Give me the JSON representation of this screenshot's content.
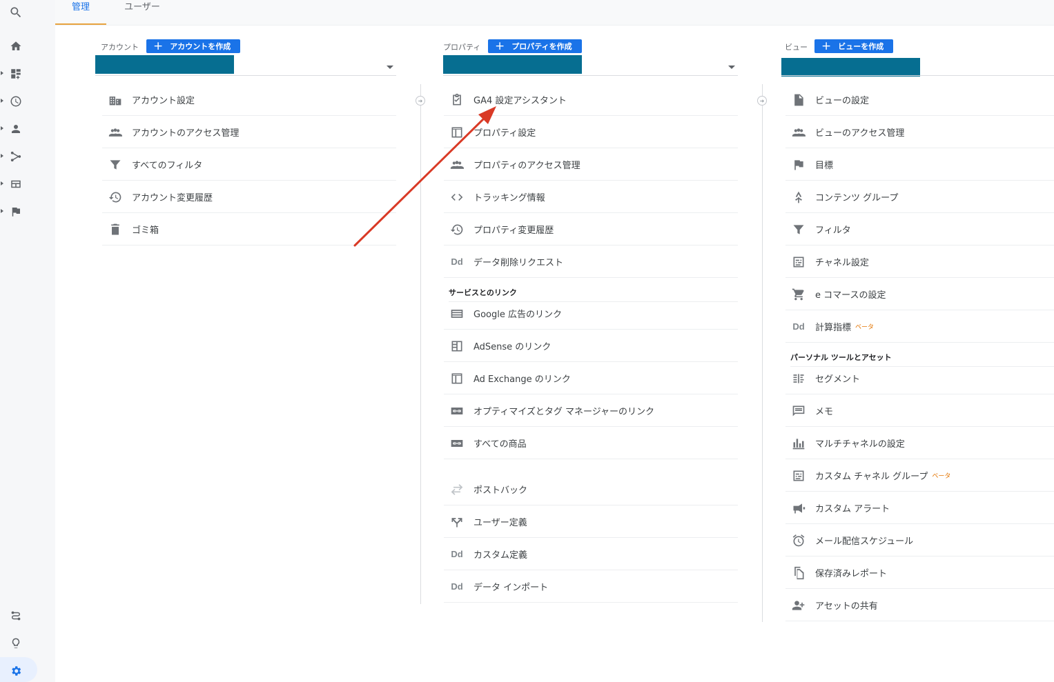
{
  "tabs": [
    {
      "label": "管理",
      "active": true
    },
    {
      "label": "ユーザー",
      "active": false
    }
  ],
  "account": {
    "label": "アカウント",
    "create_label": "アカウントを作成",
    "items": [
      {
        "label": "アカウント設定",
        "icon": "building-icon"
      },
      {
        "label": "アカウントのアクセス管理",
        "icon": "people-icon"
      },
      {
        "label": "すべてのフィルタ",
        "icon": "filter-icon"
      },
      {
        "label": "アカウント変更履歴",
        "icon": "history-icon"
      },
      {
        "label": "ゴミ箱",
        "icon": "trash-icon"
      }
    ]
  },
  "property": {
    "label": "プロパティ",
    "create_label": "プロパティを作成",
    "items": [
      {
        "label": "GA4 設定アシスタント",
        "icon": "clipboard-check-icon"
      },
      {
        "label": "プロパティ設定",
        "icon": "window-icon"
      },
      {
        "label": "プロパティのアクセス管理",
        "icon": "people-icon"
      },
      {
        "label": "トラッキング情報",
        "icon": "code-icon"
      },
      {
        "label": "プロパティ変更履歴",
        "icon": "history-icon"
      },
      {
        "label": "データ削除リクエスト",
        "icon": "dd-icon",
        "glyph": "Dd"
      }
    ],
    "section_links": "サービスとのリンク",
    "link_items": [
      {
        "label": "Google 広告のリンク",
        "icon": "ads-icon"
      },
      {
        "label": "AdSense のリンク",
        "icon": "adsense-icon"
      },
      {
        "label": "Ad Exchange のリンク",
        "icon": "window-icon"
      },
      {
        "label": "オプティマイズとタグ マネージャーのリンク",
        "icon": "link-icon"
      },
      {
        "label": "すべての商品",
        "icon": "link-icon"
      }
    ],
    "extra_items": [
      {
        "label": "ポストバック",
        "icon": "swap-icon"
      },
      {
        "label": "ユーザー定義",
        "icon": "fork-icon"
      },
      {
        "label": "カスタム定義",
        "icon": "dd-icon",
        "glyph": "Dd"
      },
      {
        "label": "データ インポート",
        "icon": "dd-icon",
        "glyph": "Dd"
      }
    ]
  },
  "view": {
    "label": "ビュー",
    "create_label": "ビューを作成",
    "items": [
      {
        "label": "ビューの設定",
        "icon": "document-icon"
      },
      {
        "label": "ビューのアクセス管理",
        "icon": "people-icon"
      },
      {
        "label": "目標",
        "icon": "flag-icon"
      },
      {
        "label": "コンテンツ グループ",
        "icon": "person-walk-icon"
      },
      {
        "label": "フィルタ",
        "icon": "filter-icon"
      },
      {
        "label": "チャネル設定",
        "icon": "channel-icon"
      },
      {
        "label": "e コマースの設定",
        "icon": "cart-icon"
      },
      {
        "label": "計算指標",
        "icon": "dd-icon",
        "glyph": "Dd",
        "beta": "ベータ"
      }
    ],
    "section_personal": "パーソナル ツールとアセット",
    "personal_items": [
      {
        "label": "セグメント",
        "icon": "segment-icon"
      },
      {
        "label": "メモ",
        "icon": "note-icon"
      },
      {
        "label": "マルチチャネルの設定",
        "icon": "bars-icon"
      },
      {
        "label": "カスタム チャネル グループ",
        "icon": "channel-icon",
        "beta": "ベータ"
      },
      {
        "label": "カスタム アラート",
        "icon": "megaphone-icon"
      },
      {
        "label": "メール配信スケジュール",
        "icon": "alarm-icon"
      },
      {
        "label": "保存済みレポート",
        "icon": "copy-icon"
      },
      {
        "label": "アセットの共有",
        "icon": "person-add-icon"
      }
    ]
  },
  "colors": {
    "accent": "#1a73e8",
    "selector": "#066e91",
    "arrow": "#d93a26",
    "tab_underline": "#e8a33d"
  }
}
